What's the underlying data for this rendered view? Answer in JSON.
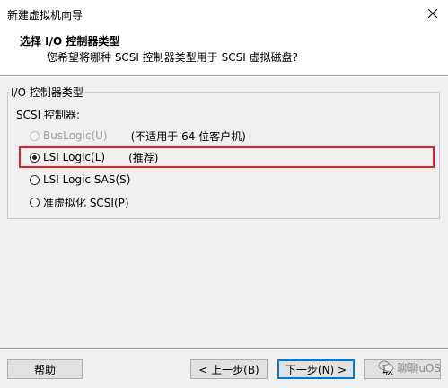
{
  "window": {
    "title": "新建虚拟机向导",
    "close_icon": "close-icon"
  },
  "header": {
    "title": "选择 I/O 控制器类型",
    "subtitle": "您希望将哪种 SCSI 控制器类型用于 SCSI 虚拟磁盘?"
  },
  "group": {
    "legend": "I/O 控制器类型",
    "scsi_label": "SCSI 控制器:",
    "options": [
      {
        "label": "BusLogic(U)",
        "note": "(不适用于 64 位客户机)",
        "checked": false,
        "disabled": true
      },
      {
        "label": "LSI Logic(L)",
        "note": "(推荐)",
        "checked": true,
        "disabled": false
      },
      {
        "label": "LSI Logic SAS(S)",
        "note": "",
        "checked": false,
        "disabled": false
      },
      {
        "label": "准虚拟化 SCSI(P)",
        "note": "",
        "checked": false,
        "disabled": false
      }
    ]
  },
  "footer": {
    "help": "帮助",
    "back": "< 上一步(B)",
    "next": "下一步(N) >",
    "cancel_partial": "取",
    "watermark": "聊聊uOS"
  },
  "colors": {
    "highlight": "#e0202a",
    "default_button_border": "#0078d7"
  }
}
